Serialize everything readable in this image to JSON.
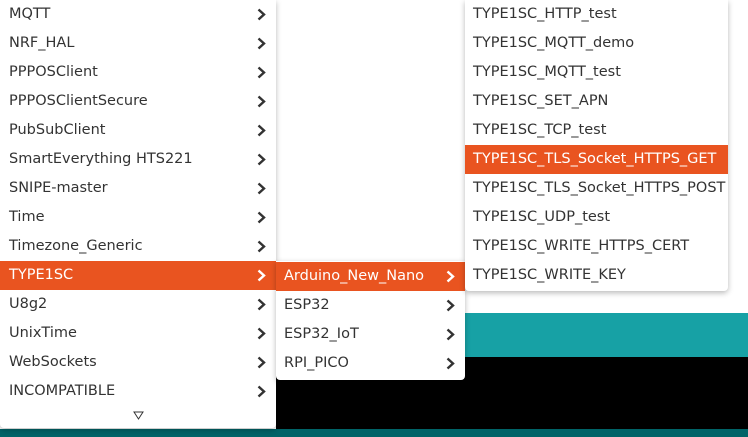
{
  "menu_libraries": {
    "items": [
      {
        "label": "MQTT"
      },
      {
        "label": "NRF_HAL"
      },
      {
        "label": "PPPOSClient"
      },
      {
        "label": "PPPOSClientSecure"
      },
      {
        "label": "PubSubClient"
      },
      {
        "label": "SmartEverything HTS221"
      },
      {
        "label": "SNIPE-master"
      },
      {
        "label": "Time"
      },
      {
        "label": "Timezone_Generic"
      },
      {
        "label": "TYPE1SC",
        "selected": true
      },
      {
        "label": "U8g2"
      },
      {
        "label": "UnixTime"
      },
      {
        "label": "WebSockets"
      },
      {
        "label": "INCOMPATIBLE"
      }
    ],
    "scroll_down_icon": "triangle-down-outline"
  },
  "menu_boards": {
    "items": [
      {
        "label": "Arduino_New_Nano",
        "selected": true
      },
      {
        "label": "ESP32"
      },
      {
        "label": "ESP32_IoT"
      },
      {
        "label": "RPI_PICO"
      }
    ]
  },
  "menu_examples": {
    "items": [
      {
        "label": "TYPE1SC_HTTP_test"
      },
      {
        "label": "TYPE1SC_MQTT_demo"
      },
      {
        "label": "TYPE1SC_MQTT_test"
      },
      {
        "label": "TYPE1SC_SET_APN"
      },
      {
        "label": "TYPE1SC_TCP_test"
      },
      {
        "label": "TYPE1SC_TLS_Socket_HTTPS_GET",
        "selected": true
      },
      {
        "label": "TYPE1SC_TLS_Socket_HTTPS_POST"
      },
      {
        "label": "TYPE1SC_UDP_test"
      },
      {
        "label": "TYPE1SC_WRITE_HTTPS_CERT"
      },
      {
        "label": "TYPE1SC_WRITE_KEY"
      }
    ]
  },
  "colors": {
    "selection": "#e95420",
    "teal_bar": "#17a1a5",
    "console": "#000000",
    "footer": "#006468"
  }
}
